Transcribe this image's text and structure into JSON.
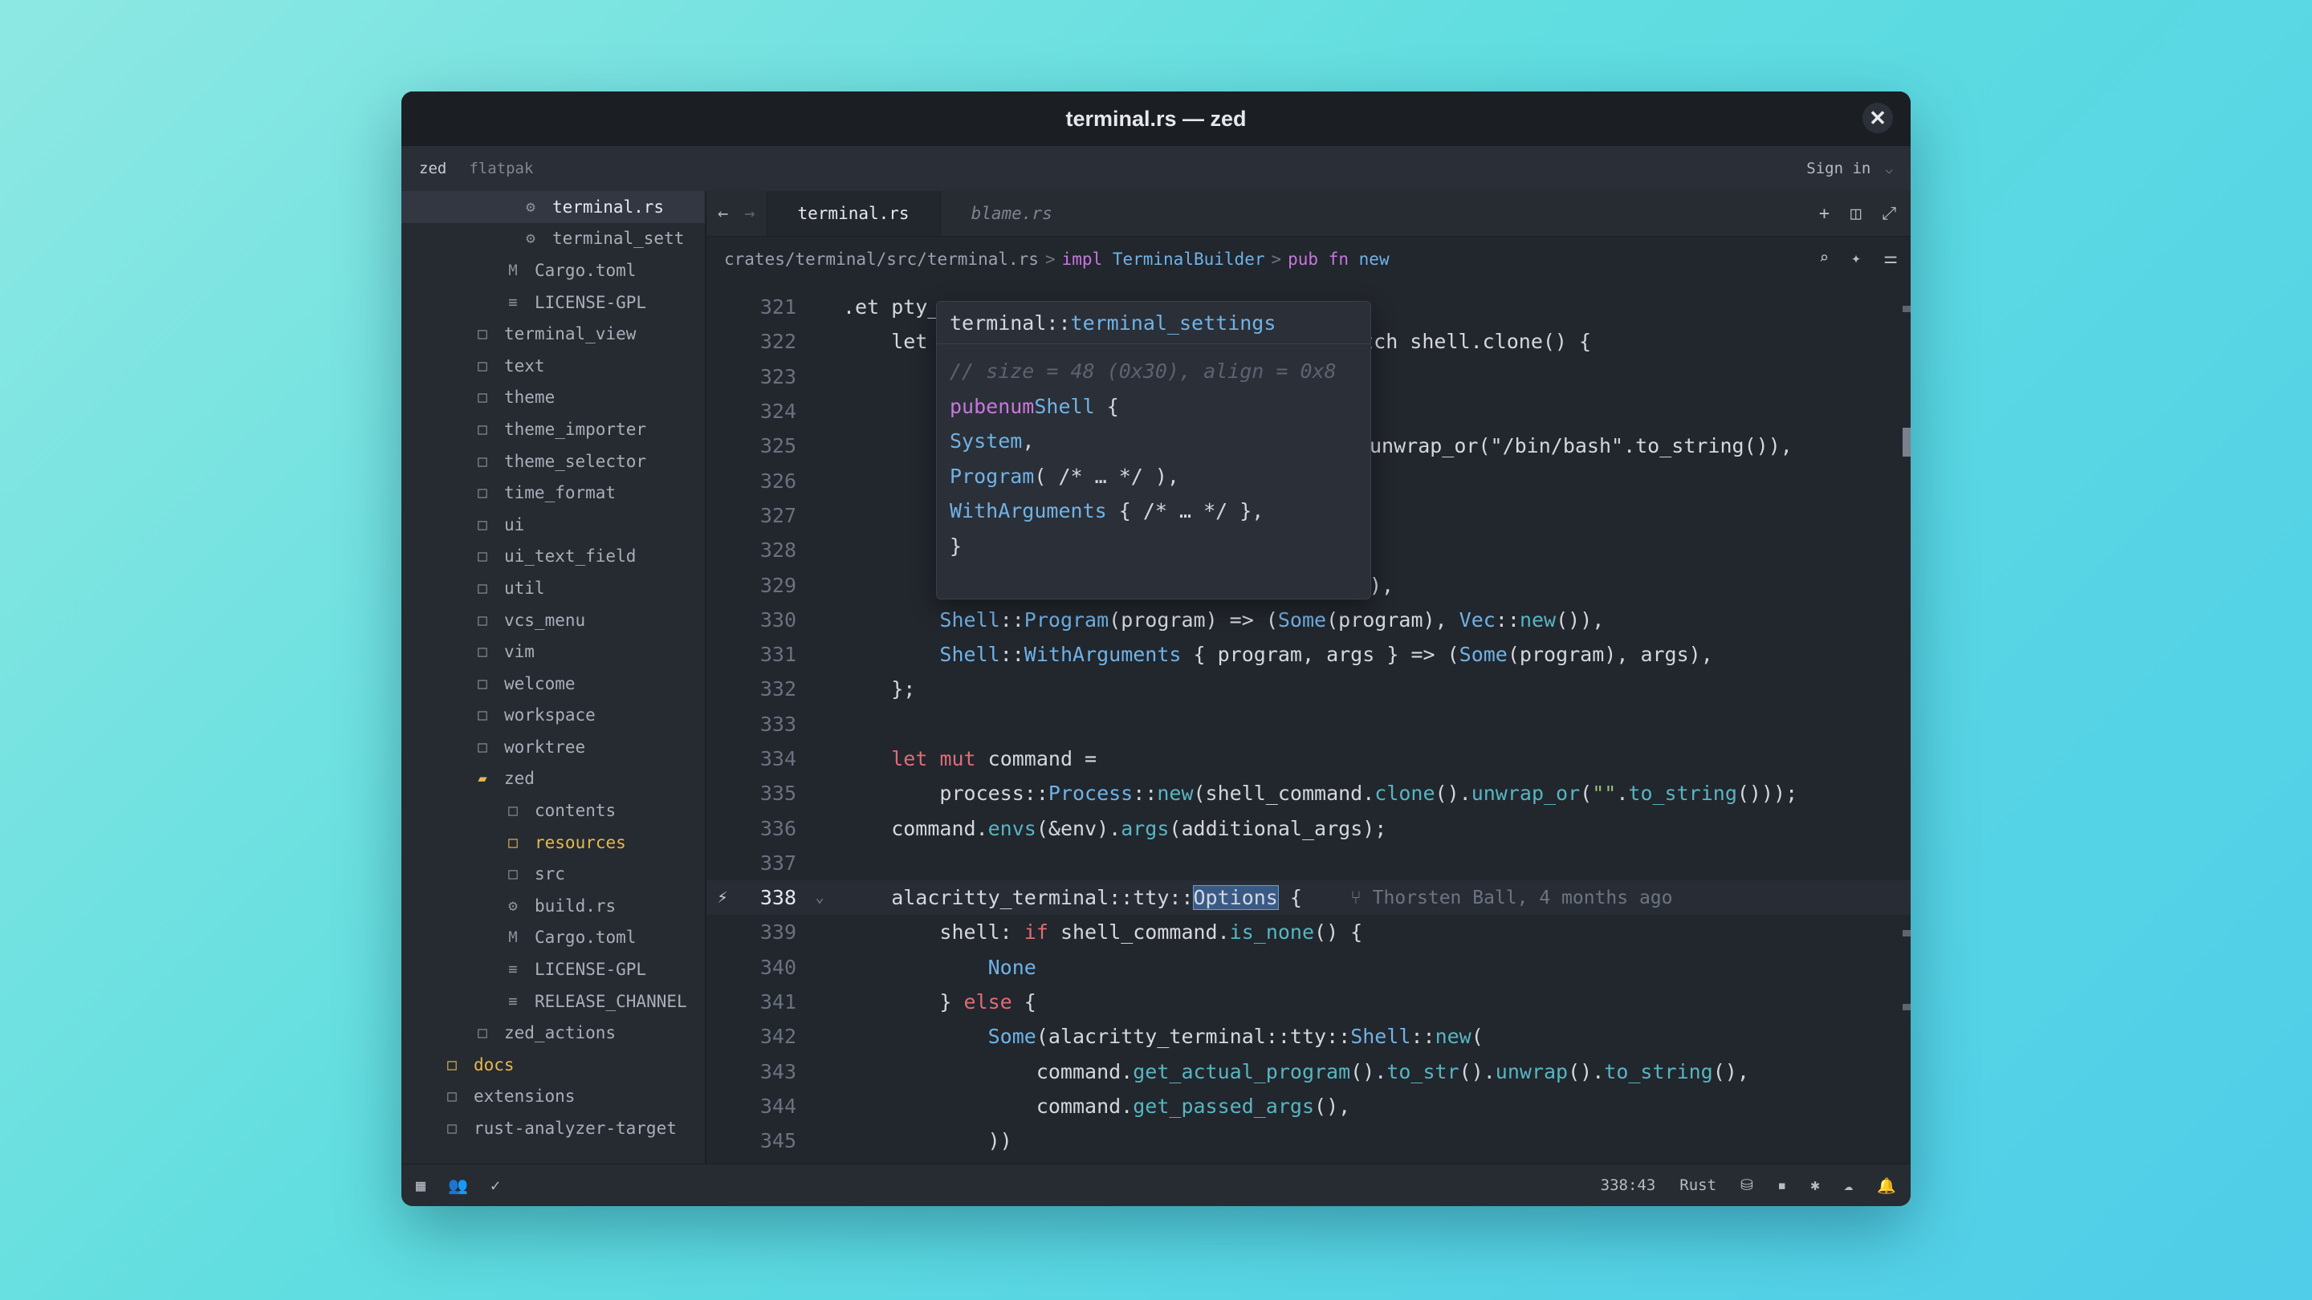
{
  "window": {
    "title": "terminal.rs — zed",
    "close_label": "✕"
  },
  "topbar": {
    "project": "zed",
    "branch": "flatpak",
    "sign_in": "Sign in",
    "chevron": "⌵"
  },
  "sidebar": {
    "items": [
      {
        "label": "terminal.rs",
        "icon": "⚙",
        "indent": 150,
        "active": true
      },
      {
        "label": "terminal_sett",
        "icon": "⚙",
        "indent": 150
      },
      {
        "label": "Cargo.toml",
        "icon": "M",
        "indent": 128
      },
      {
        "label": "LICENSE-GPL",
        "icon": "≡",
        "indent": 128
      },
      {
        "label": "terminal_view",
        "icon": "□",
        "indent": 90
      },
      {
        "label": "text",
        "icon": "□",
        "indent": 90
      },
      {
        "label": "theme",
        "icon": "□",
        "indent": 90
      },
      {
        "label": "theme_importer",
        "icon": "□",
        "indent": 90
      },
      {
        "label": "theme_selector",
        "icon": "□",
        "indent": 90
      },
      {
        "label": "time_format",
        "icon": "□",
        "indent": 90
      },
      {
        "label": "ui",
        "icon": "□",
        "indent": 90
      },
      {
        "label": "ui_text_field",
        "icon": "□",
        "indent": 90
      },
      {
        "label": "util",
        "icon": "□",
        "indent": 90
      },
      {
        "label": "vcs_menu",
        "icon": "□",
        "indent": 90
      },
      {
        "label": "vim",
        "icon": "□",
        "indent": 90
      },
      {
        "label": "welcome",
        "icon": "□",
        "indent": 90
      },
      {
        "label": "workspace",
        "icon": "□",
        "indent": 90
      },
      {
        "label": "worktree",
        "icon": "□",
        "indent": 90
      },
      {
        "label": "zed",
        "icon": "▰",
        "indent": 90,
        "open": true
      },
      {
        "label": "contents",
        "icon": "□",
        "indent": 128
      },
      {
        "label": "resources",
        "icon": "□",
        "indent": 128,
        "highlight": true
      },
      {
        "label": "src",
        "icon": "□",
        "indent": 128
      },
      {
        "label": "build.rs",
        "icon": "⚙",
        "indent": 128
      },
      {
        "label": "Cargo.toml",
        "icon": "M",
        "indent": 128
      },
      {
        "label": "LICENSE-GPL",
        "icon": "≡",
        "indent": 128
      },
      {
        "label": "RELEASE_CHANNEL",
        "icon": "≡",
        "indent": 128
      },
      {
        "label": "zed_actions",
        "icon": "□",
        "indent": 90
      },
      {
        "label": "docs",
        "icon": "□",
        "indent": 52,
        "highlight": true
      },
      {
        "label": "extensions",
        "icon": "□",
        "indent": 52
      },
      {
        "label": "rust-analyzer-target",
        "icon": "□",
        "indent": 52
      }
    ]
  },
  "tabs": [
    {
      "label": "terminal.rs",
      "active": true
    },
    {
      "label": "blame.rs",
      "active": false
    }
  ],
  "nav": {
    "back": "←",
    "forward": "→"
  },
  "tab_actions": {
    "new": "+",
    "split": "◫",
    "zoom": "⤢"
  },
  "breadcrumb": {
    "path": "crates/terminal/src/terminal.rs",
    "sep": ">",
    "impl_kw": "impl",
    "impl_type": "TerminalBuilder",
    "fn_kw": "pub fn",
    "fn_name": "new"
  },
  "editor_actions": {
    "search": "⌕",
    "assist": "✦",
    "settings": "⚌"
  },
  "hover": {
    "module": "terminal",
    "sep": "::",
    "path": "terminal_settings",
    "lines": [
      "// size = 48 (0x30), align = 0x8",
      "pub enum Shell {",
      "    System,",
      "    Program( /* … */ ),",
      "    WithArguments { /* … */ },",
      "}"
    ]
  },
  "code": {
    "current_line": 338,
    "blame": "Thorsten Ball, 4 months ago",
    "lines": [
      {
        "n": "321",
        "text": ".et pty_o",
        "tail": ""
      },
      {
        "n": "322",
        "text": "    let",
        "tail": "match shell.clone() {"
      },
      {
        "n": "323",
        "text": "",
        "tail": ""
      },
      {
        "n": "324",
        "text": "",
        "tail": ""
      },
      {
        "n": "325",
        "text": "",
        "tail": "unwrap_or(\"/bin/bash\".to_string()),"
      },
      {
        "n": "326",
        "text": "",
        "tail": ""
      },
      {
        "n": "327",
        "text": "",
        "tail": ""
      },
      {
        "n": "328",
        "text": "",
        "tail": ""
      },
      {
        "n": "329",
        "text": "",
        "tail": "),"
      },
      {
        "n": "330",
        "text": "        Shell::Program(program) => (Some(program), Vec::new()),",
        "tail": ""
      },
      {
        "n": "331",
        "text": "        Shell::WithArguments { program, args } => (Some(program), args),",
        "tail": ""
      },
      {
        "n": "332",
        "text": "    };",
        "tail": ""
      },
      {
        "n": "333",
        "text": "",
        "tail": ""
      },
      {
        "n": "334",
        "text": "    let mut command =",
        "tail": ""
      },
      {
        "n": "335",
        "text": "        process::Process::new(shell_command.clone().unwrap_or(\"\".to_string()));",
        "tail": ""
      },
      {
        "n": "336",
        "text": "    command.envs(&env).args(additional_args);",
        "tail": ""
      },
      {
        "n": "337",
        "text": "",
        "tail": ""
      },
      {
        "n": "338",
        "text": "    alacritty_terminal::tty::Options {",
        "tail": ""
      },
      {
        "n": "339",
        "text": "        shell: if shell_command.is_none() {",
        "tail": ""
      },
      {
        "n": "340",
        "text": "            None",
        "tail": ""
      },
      {
        "n": "341",
        "text": "        } else {",
        "tail": ""
      },
      {
        "n": "342",
        "text": "            Some(alacritty_terminal::tty::Shell::new(",
        "tail": ""
      },
      {
        "n": "343",
        "text": "                command.get_actual_program().to_str().unwrap().to_string(),",
        "tail": ""
      },
      {
        "n": "344",
        "text": "                command.get_passed_args(),",
        "tail": ""
      },
      {
        "n": "345",
        "text": "            ))",
        "tail": ""
      }
    ]
  },
  "statusbar": {
    "left_icons": [
      "▦",
      "👥",
      "✓"
    ],
    "position": "338:43",
    "language": "Rust",
    "right_icons": [
      "⛁",
      "▪",
      "✱",
      "☁",
      "🔔"
    ]
  },
  "colors": {
    "keyword": "#e06c75",
    "keyword_alt": "#c678dd",
    "type": "#6fb3e6",
    "function": "#56b6c2",
    "string": "#98c379",
    "comment": "#5c6370",
    "folder_highlight": "#e5b94a",
    "background": "#22262d"
  }
}
